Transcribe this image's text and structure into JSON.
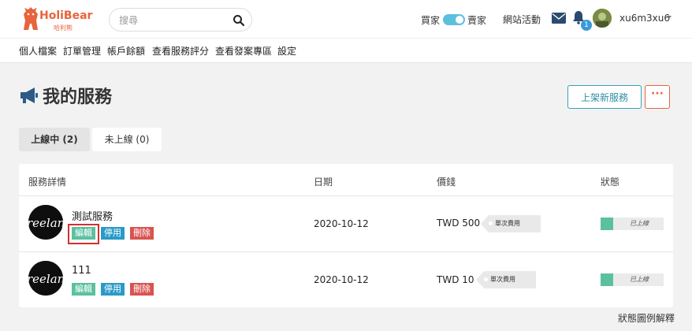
{
  "header": {
    "logo_text": "HoliBear",
    "logo_sub": "哈利熊",
    "search_placeholder": "搜尋",
    "mode_buyer": "買家",
    "mode_seller": "賣家",
    "site_activity": "網站活動",
    "notification_count": "1",
    "username": "xu6m3xu6"
  },
  "nav": {
    "items": [
      "個人檔案",
      "訂單管理",
      "帳戶餘額",
      "查看服務評分",
      "查看發案專區",
      "設定"
    ]
  },
  "page": {
    "title": "我的服務",
    "new_service_label": "上架新服務",
    "more_label": "···"
  },
  "tabs": {
    "online": "上線中 (2)",
    "offline": "未上線 (0)"
  },
  "table": {
    "headers": {
      "details": "服務詳情",
      "date": "日期",
      "price": "價錢",
      "status": "狀態"
    },
    "rows": [
      {
        "name": "測試服務",
        "avatar_text": "reelanc",
        "edit": "編輯",
        "pause": "停用",
        "delete": "刪除",
        "date": "2020-10-12",
        "price": "TWD 500",
        "price_type": "單次費用",
        "status": "已上線"
      },
      {
        "name": "111",
        "avatar_text": "reelanc",
        "edit": "編輯",
        "pause": "停用",
        "delete": "刪除",
        "date": "2020-10-12",
        "price": "TWD 10",
        "price_type": "單次費用",
        "status": "已上線"
      }
    ]
  },
  "legend_link": "狀態圖例解釋",
  "colors": {
    "brand": "#e8643c",
    "accent": "#3a9fb4",
    "edit": "#5bc0a0",
    "pause": "#2a9ac8",
    "delete": "#d9534f",
    "highlight": "#d32f2f"
  }
}
